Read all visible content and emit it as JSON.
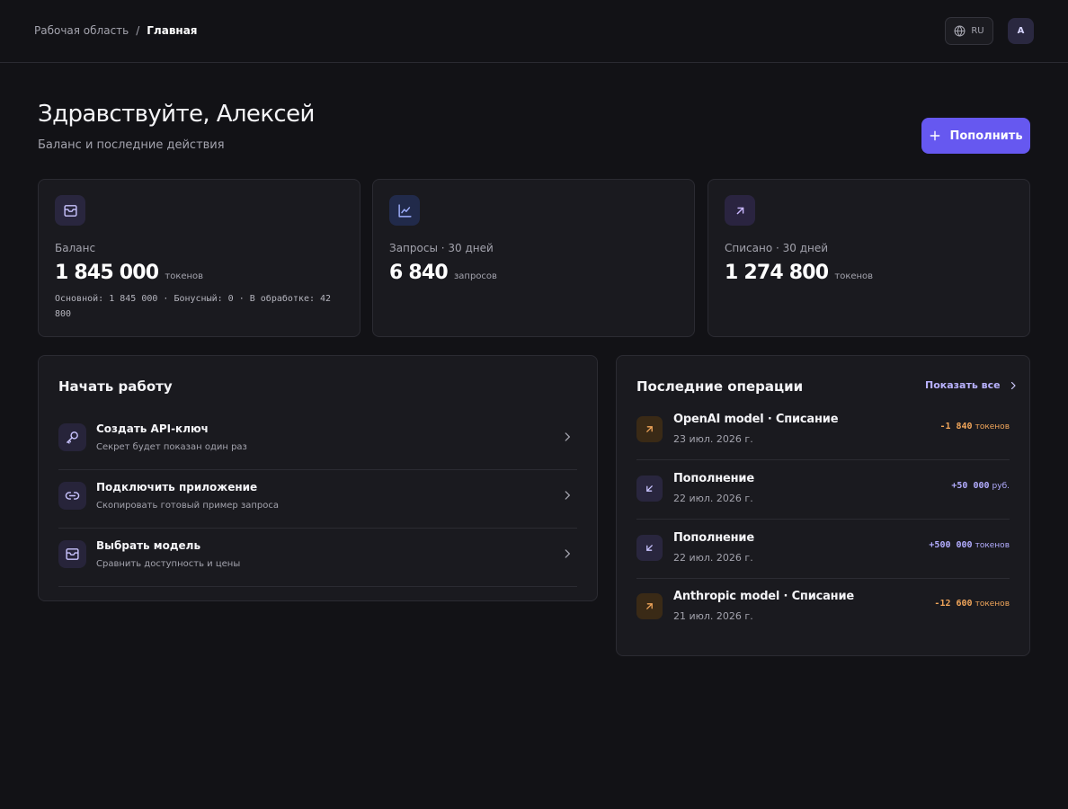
{
  "header": {
    "breadcrumb": {
      "root": "Рабочая область",
      "separator": "/",
      "current": "Главная"
    },
    "language": {
      "icon": "globe-icon",
      "label": "RU"
    },
    "avatar": {
      "initial": "A"
    }
  },
  "page": {
    "title": "Здравствуйте, Алексей",
    "subtitle": "Баланс и последние действия",
    "primary_action": {
      "icon": "plus-icon",
      "label": "Пополнить"
    }
  },
  "stats": [
    {
      "icon": "wallet-icon",
      "label": "Баланс",
      "value": "1 845 000",
      "unit": "токенов",
      "breakdown": "Основной: 1 845 000 · Бонусный: 0 · В обработке: 42 800"
    },
    {
      "icon": "chart-line-icon",
      "label": "Запросы · 30 дней",
      "value": "6 840",
      "unit": "запросов"
    },
    {
      "icon": "arrow-up-right-icon",
      "label": "Списано · 30 дней",
      "value": "1 274 800",
      "unit": "токенов"
    }
  ],
  "getting_started": {
    "title": "Начать работу",
    "items": [
      {
        "icon": "key-icon",
        "title": "Создать API-ключ",
        "description": "Секрет будет показан один раз"
      },
      {
        "icon": "link-icon",
        "title": "Подключить приложение",
        "description": "Скопировать готовый пример запроса"
      },
      {
        "icon": "box-icon",
        "title": "Выбрать модель",
        "description": "Сравнить доступность и цены"
      }
    ]
  },
  "recent_operations": {
    "title": "Последние операции",
    "show_all_label": "Показать все",
    "items": [
      {
        "direction": "out",
        "icon": "arrow-up-right-icon",
        "title": "OpenAI model · Списание",
        "date": "23 июл. 2026 г.",
        "amount": "-1 840",
        "currency": "токенов"
      },
      {
        "direction": "in",
        "icon": "arrow-down-left-icon",
        "title": "Пополнение",
        "date": "22 июл. 2026 г.",
        "amount": "+50 000",
        "currency": "руб."
      },
      {
        "direction": "in",
        "icon": "arrow-down-left-icon",
        "title": "Пополнение",
        "date": "22 июл. 2026 г.",
        "amount": "+500 000",
        "currency": "токенов"
      },
      {
        "direction": "out",
        "icon": "arrow-up-right-icon",
        "title": "Anthropic model · Списание",
        "date": "21 июл. 2026 г.",
        "amount": "-12 600",
        "currency": "токенов"
      }
    ]
  },
  "colors": {
    "background": "#121216",
    "card": "#1a1a1f",
    "accent": "#6658f0",
    "negative": "#f0a55a",
    "positive": "#b3adff"
  }
}
